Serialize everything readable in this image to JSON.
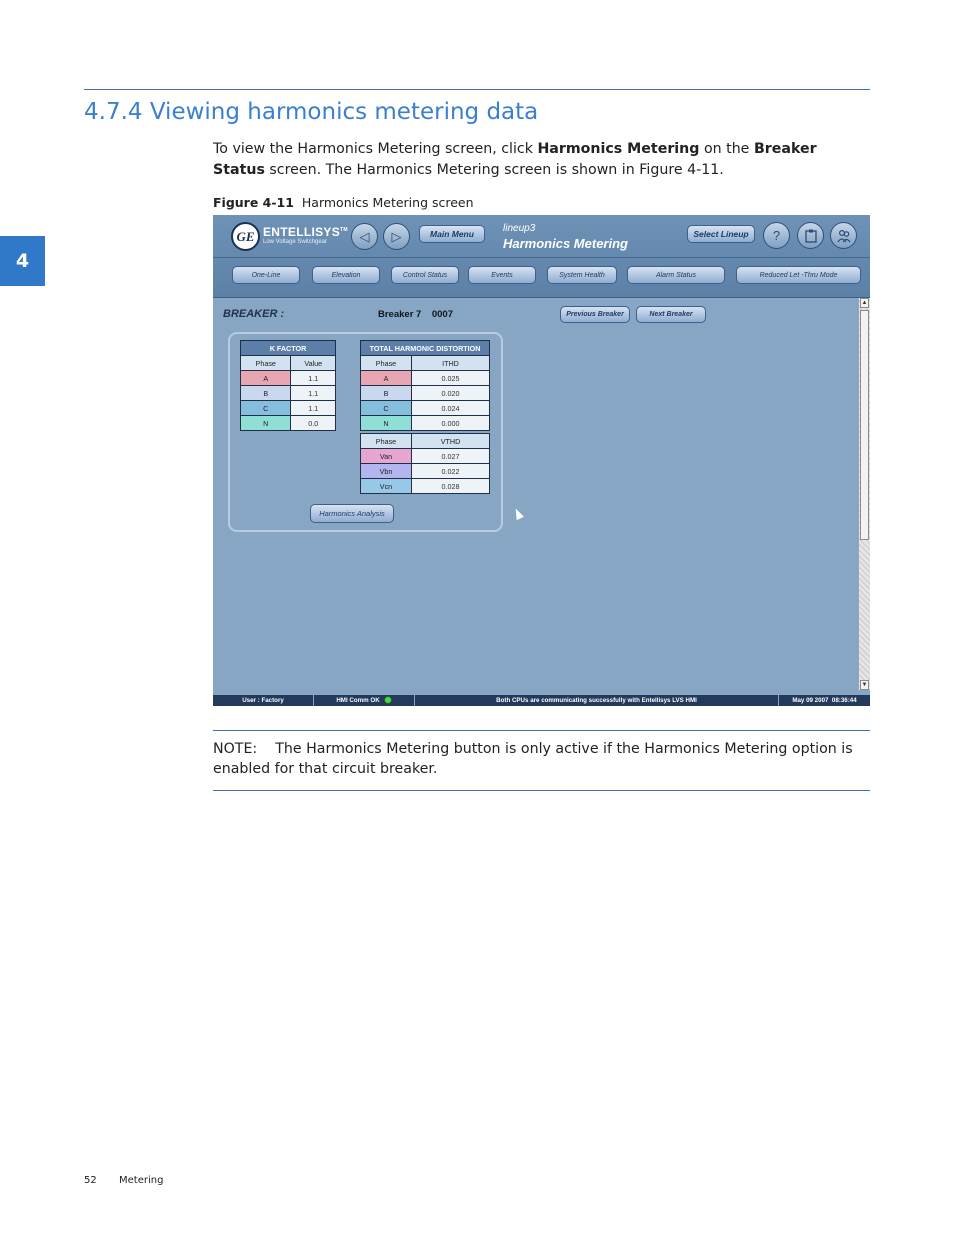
{
  "section": {
    "title": "4.7.4 Viewing harmonics metering data",
    "chapter_tab": "4"
  },
  "intro": {
    "p1": "To view the Harmonics Metering screen, click ",
    "b1": "Harmonics Metering",
    "p2": " on the ",
    "b2": "Breaker Status",
    "p3": " screen. The Harmonics Metering screen is shown in Figure 4-11."
  },
  "figure": {
    "number": "Figure 4-11",
    "caption": "Harmonics Metering screen"
  },
  "screen": {
    "logo_text": "GE",
    "brand": "ENTELLISYS",
    "brand_tm": "TM",
    "brand_sub": "Low Voltage Switchgear",
    "main_menu": "Main Menu",
    "lineup": "lineup3",
    "title": "Harmonics Metering",
    "select_lineup": "Select Lineup",
    "help": "?",
    "back_glyph": "◁",
    "forward_glyph": "▷",
    "nav": [
      "One-Line",
      "Elevation",
      "Control Status",
      "Events",
      "System Health",
      "Alarm Status",
      "Reduced Let -Thru Mode"
    ],
    "breaker_label": "BREAKER :",
    "breaker_name": "Breaker 7    0007",
    "previous_breaker": "Previous Breaker",
    "next_breaker": "Next Breaker",
    "harmonics_analysis": "Harmonics Analysis",
    "k_factor": {
      "title": "K FACTOR",
      "columns": [
        "Phase",
        "Value"
      ],
      "rows": [
        [
          "A",
          "1.1"
        ],
        [
          "B",
          "1.1"
        ],
        [
          "C",
          "1.1"
        ],
        [
          "N",
          "0.0"
        ]
      ]
    },
    "thd": {
      "title": "TOTAL HARMONIC DISTORTION",
      "columns": [
        "Phase",
        "ITHD"
      ],
      "rows": [
        [
          "A",
          "0.025"
        ],
        [
          "B",
          "0.020"
        ],
        [
          "C",
          "0.024"
        ],
        [
          "N",
          "0.000"
        ]
      ],
      "v_columns": [
        "Phase",
        "VTHD"
      ],
      "v_rows": [
        [
          "Van",
          "0.027"
        ],
        [
          "Vbn",
          "0.022"
        ],
        [
          "Vcn",
          "0.028"
        ]
      ]
    },
    "status": {
      "user": "User : Factory",
      "hmi": "HMI Comm OK",
      "message": "Both CPUs are communicating successfully with Entellisys LVS HMI",
      "datetime": "May 09 2007  08:36:44"
    },
    "colors": {
      "header": "#6f93b7",
      "background": "#86a6c3",
      "statusbar": "#233a5c"
    }
  },
  "note": "NOTE:    The Harmonics Metering button is only active if the Harmonics Metering option is enabled for that circuit breaker.",
  "footer": {
    "page": "52",
    "section": "Metering"
  }
}
